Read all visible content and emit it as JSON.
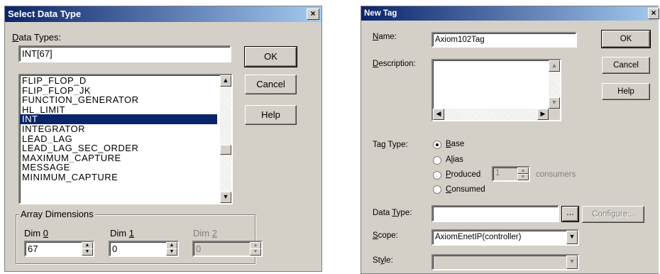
{
  "select_dialog": {
    "title": "Select Data Type",
    "close_glyph": "×",
    "data_types_label": "Data Types:",
    "data_types_value": "INT[67]",
    "ok_label": "OK",
    "cancel_label": "Cancel",
    "help_label": "Help",
    "list_items": [
      "FLIP_FLOP_D",
      "FLIP_FLOP_JK",
      "FUNCTION_GENERATOR",
      "HL_LIMIT",
      "INT",
      "INTEGRATOR",
      "LEAD_LAG",
      "LEAD_LAG_SEC_ORDER",
      "MAXIMUM_CAPTURE",
      "MESSAGE",
      "MINIMUM_CAPTURE"
    ],
    "selected_item": "INT",
    "array_dimensions_label": "Array Dimensions",
    "dim0_label": "Dim 0",
    "dim1_label": "Dim 1",
    "dim2_label": "Dim 2",
    "dim0_value": "67",
    "dim1_value": "0",
    "dim2_value": "0"
  },
  "new_tag_dialog": {
    "title": "New Tag",
    "close_glyph": "×",
    "name_label": "Name:",
    "name_value": "Axiom102Tag",
    "description_label": "Description:",
    "ok_label": "OK",
    "cancel_label": "Cancel",
    "help_label": "Help",
    "tag_type_label": "Tag Type:",
    "tag_types": [
      "Base",
      "Alias",
      "Produced",
      "Consumed"
    ],
    "selected_tag_type": "Base",
    "consumers_value": "1",
    "consumers_label": "consumers",
    "data_type_label": "Data Type:",
    "data_type_value": "",
    "ellipsis_label": "...",
    "configure_label": "Configure...",
    "scope_label": "Scope:",
    "scope_value": "AxiomEnetIP(controller)",
    "style_label": "Style:",
    "style_value": ""
  },
  "colors": {
    "dialog_bg": "#d4d0c8",
    "title_start": "#0a246a",
    "title_end": "#a6caf0",
    "selection": "#0a246a"
  },
  "icons": [
    "close-icon",
    "scroll-up-arrow-icon",
    "scroll-down-arrow-icon",
    "scroll-left-arrow-icon",
    "scroll-right-arrow-icon",
    "spin-up-icon",
    "spin-down-icon",
    "dropdown-arrow-icon"
  ]
}
